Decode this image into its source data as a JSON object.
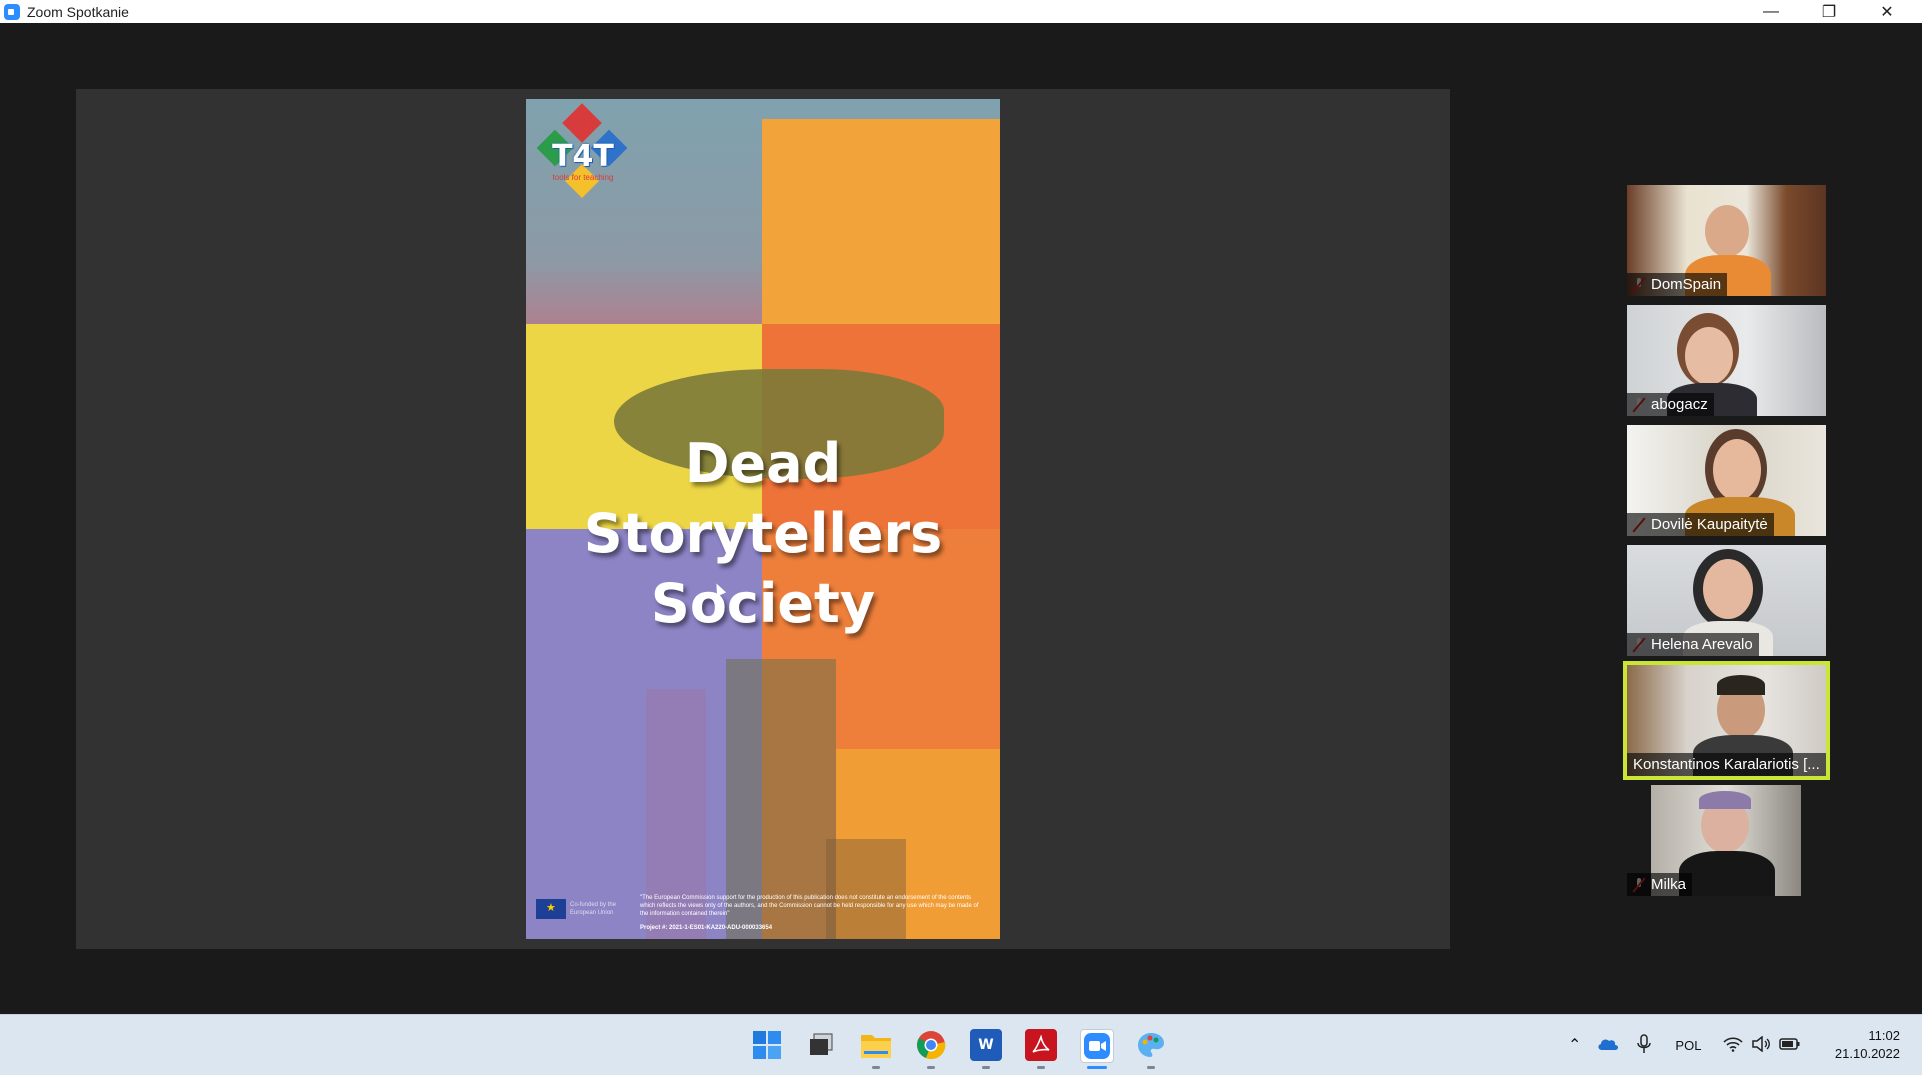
{
  "window": {
    "title": "Zoom Spotkanie",
    "minimize_glyph": "—",
    "restore_glyph": "❐",
    "close_glyph": "✕"
  },
  "share": {
    "poster_title_lines": [
      "Dead",
      "Storytellers",
      "Society"
    ],
    "logo_text": "T4T",
    "logo_subtitle": "tools for teaching",
    "eu_text": "Co-funded by the European Union",
    "disclaimer": "\"The European Commission support for the production of this publication does not constitute an endorsement of the contents which reflects the views only of the authors, and the Commission cannot be held responsible for any use which may be made of the information contained therein\"",
    "project_number": "Project #: 2021-1-ES01-KA220-ADU-000033654"
  },
  "participants": [
    {
      "name": "DomSpain",
      "muted": true,
      "active": false
    },
    {
      "name": "abogacz",
      "muted": true,
      "active": false
    },
    {
      "name": "Dovilė Kaupaitytė",
      "muted": true,
      "active": false
    },
    {
      "name": "Helena Arevalo",
      "muted": true,
      "active": false
    },
    {
      "name": "Konstantinos Karalariotis [...",
      "muted": false,
      "active": true
    },
    {
      "name": "Milka",
      "muted": true,
      "active": false
    }
  ],
  "taskbar": {
    "apps": [
      "windows-start",
      "task-view",
      "file-explorer",
      "chrome",
      "word",
      "acrobat",
      "zoom",
      "paint"
    ],
    "language": "POL",
    "time": "11:02",
    "date": "21.10.2022"
  },
  "colors": {
    "active_speaker": "#c9e635",
    "zoom_blue": "#2d8cff"
  }
}
